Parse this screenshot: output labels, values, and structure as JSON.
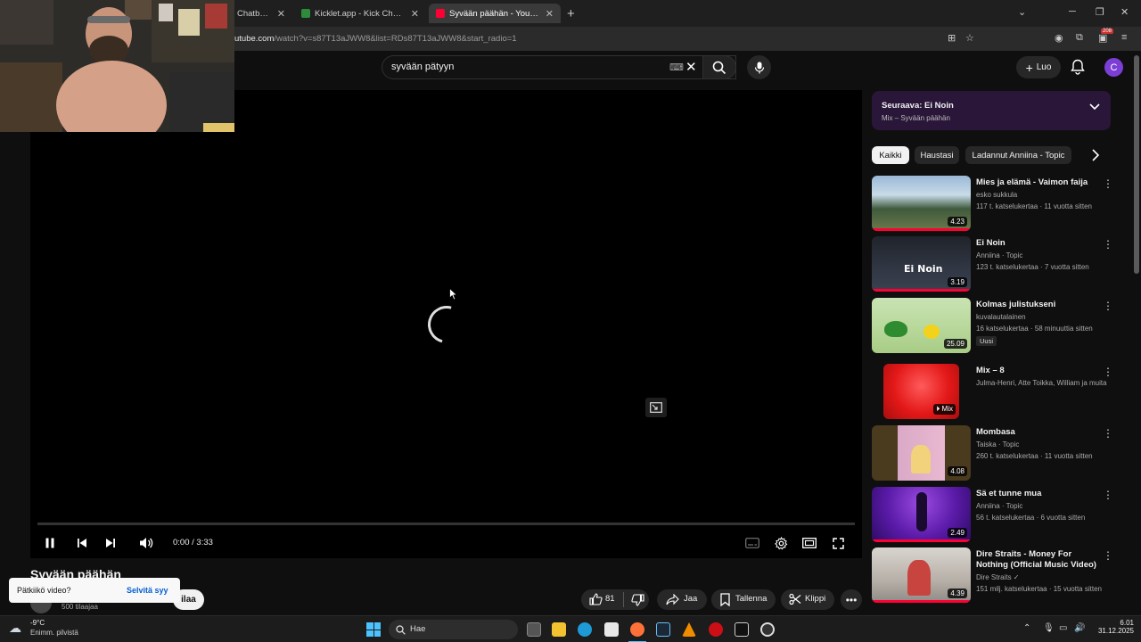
{
  "browser": {
    "tabs": [
      {
        "label": "Chatbot and (",
        "active": false
      },
      {
        "label": "Kicklet.app - Kick Chatbot and (",
        "active": false
      },
      {
        "label": "Syvään päähän - YouTube",
        "active": true
      }
    ],
    "url_host": "utube.com",
    "url_path": "/watch?v=s87T13aJWW8&list=RDs87T13aJWW8&start_radio=1",
    "extension_badge": "208"
  },
  "youtube": {
    "search_query": "syvään pätyyn",
    "create_label": "Luo",
    "avatar_letter": "C"
  },
  "player": {
    "time": "0:00 / 3:33",
    "progress": 0
  },
  "video": {
    "title": "Syvään päähän",
    "subscribers": "500 tilaajaa",
    "subscribe_label": "ilaa",
    "likes": "81",
    "share_label": "Jaa",
    "save_label": "Tallenna",
    "clip_label": "Klippi"
  },
  "toast": {
    "message": "Pätkiikö video?",
    "action": "Selvitä syy"
  },
  "sidebar": {
    "up_next_title": "Seuraava: Ei Noin",
    "up_next_sub": "Mix – Syvään päähän",
    "chips": [
      "Kaikki",
      "Haustasi",
      "Ladannut Anniina - Topic"
    ],
    "videos": [
      {
        "title": "Mies ja elämä - Vaimon faija",
        "channel": "esko sukkula",
        "meta": "117 t. katselukertaa · 11 vuotta sitten",
        "duration": "4.23",
        "badge": ""
      },
      {
        "title": "Ei Noin",
        "channel": "Anniina · Topic",
        "meta": "123 t. katselukertaa · 7 vuotta sitten",
        "duration": "3.19",
        "badge": ""
      },
      {
        "title": "Kolmas julistukseni",
        "channel": "kuvalautalainen",
        "meta": "16 katselukertaa · 58 minuuttia sitten",
        "duration": "25.09",
        "badge": "Uusi"
      },
      {
        "title": "Mix – 8",
        "channel": "Julma-Henri, Atte Toikka, William ja muita",
        "meta": "",
        "duration": "Mix",
        "badge": ""
      },
      {
        "title": "Mombasa",
        "channel": "Taiska · Topic",
        "meta": "260 t. katselukertaa · 11 vuotta sitten",
        "duration": "4.08",
        "badge": ""
      },
      {
        "title": "Sä et tunne mua",
        "channel": "Anniina · Topic",
        "meta": "56 t. katselukertaa · 6 vuotta sitten",
        "duration": "2.49",
        "badge": ""
      },
      {
        "title": "Dire Straits - Money For Nothing (Official Music Video)",
        "channel": "Dire Straits",
        "meta": "151 milj. katselukertaa · 15 vuotta sitten",
        "duration": "4.39",
        "badge": ""
      }
    ]
  },
  "taskbar": {
    "temperature": "-9°C",
    "weather": "Enimm. pilvistä",
    "search_placeholder": "Hae",
    "time": "6.01",
    "date": "31.12.2025"
  },
  "colors": {
    "accent": "#ff0033",
    "up_next_bg": "#2a1638",
    "avatar": "#7b3fd6"
  }
}
